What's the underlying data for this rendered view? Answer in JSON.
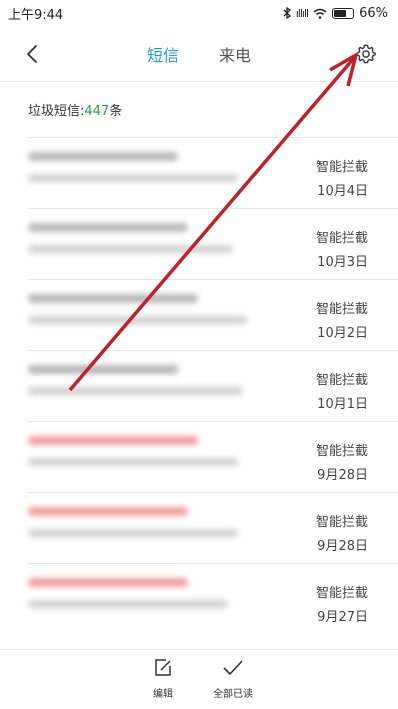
{
  "status_bar": {
    "time": "上午9:44",
    "signal": "ıllıll",
    "battery_percent": "66%",
    "battery_level": 0.66
  },
  "header": {
    "tabs": [
      {
        "label": "短信",
        "active": true
      },
      {
        "label": "来电",
        "active": false
      }
    ],
    "back_icon": "chevron-left-icon",
    "settings_icon": "gear-icon",
    "accent_color": "#1da1d8"
  },
  "summary": {
    "prefix": "垃圾短信:",
    "count": "447",
    "suffix": "条",
    "count_color": "#2e9f3d"
  },
  "messages": [
    {
      "tag": "智能拦截",
      "date": "10月4日",
      "sender_red": false
    },
    {
      "tag": "智能拦截",
      "date": "10月3日",
      "sender_red": false
    },
    {
      "tag": "智能拦截",
      "date": "10月2日",
      "sender_red": false
    },
    {
      "tag": "智能拦截",
      "date": "10月1日",
      "sender_red": false
    },
    {
      "tag": "智能拦截",
      "date": "9月28日",
      "sender_red": true
    },
    {
      "tag": "智能拦截",
      "date": "9月28日",
      "sender_red": true
    },
    {
      "tag": "智能拦截",
      "date": "9月27日",
      "sender_red": true
    }
  ],
  "footer": {
    "edit_label": "编辑",
    "edit_icon": "edit-icon",
    "mark_all_read_label": "全部已读",
    "mark_all_read_icon": "checkmark-icon"
  },
  "annotation": {
    "arrow_color": "#c0202a"
  }
}
